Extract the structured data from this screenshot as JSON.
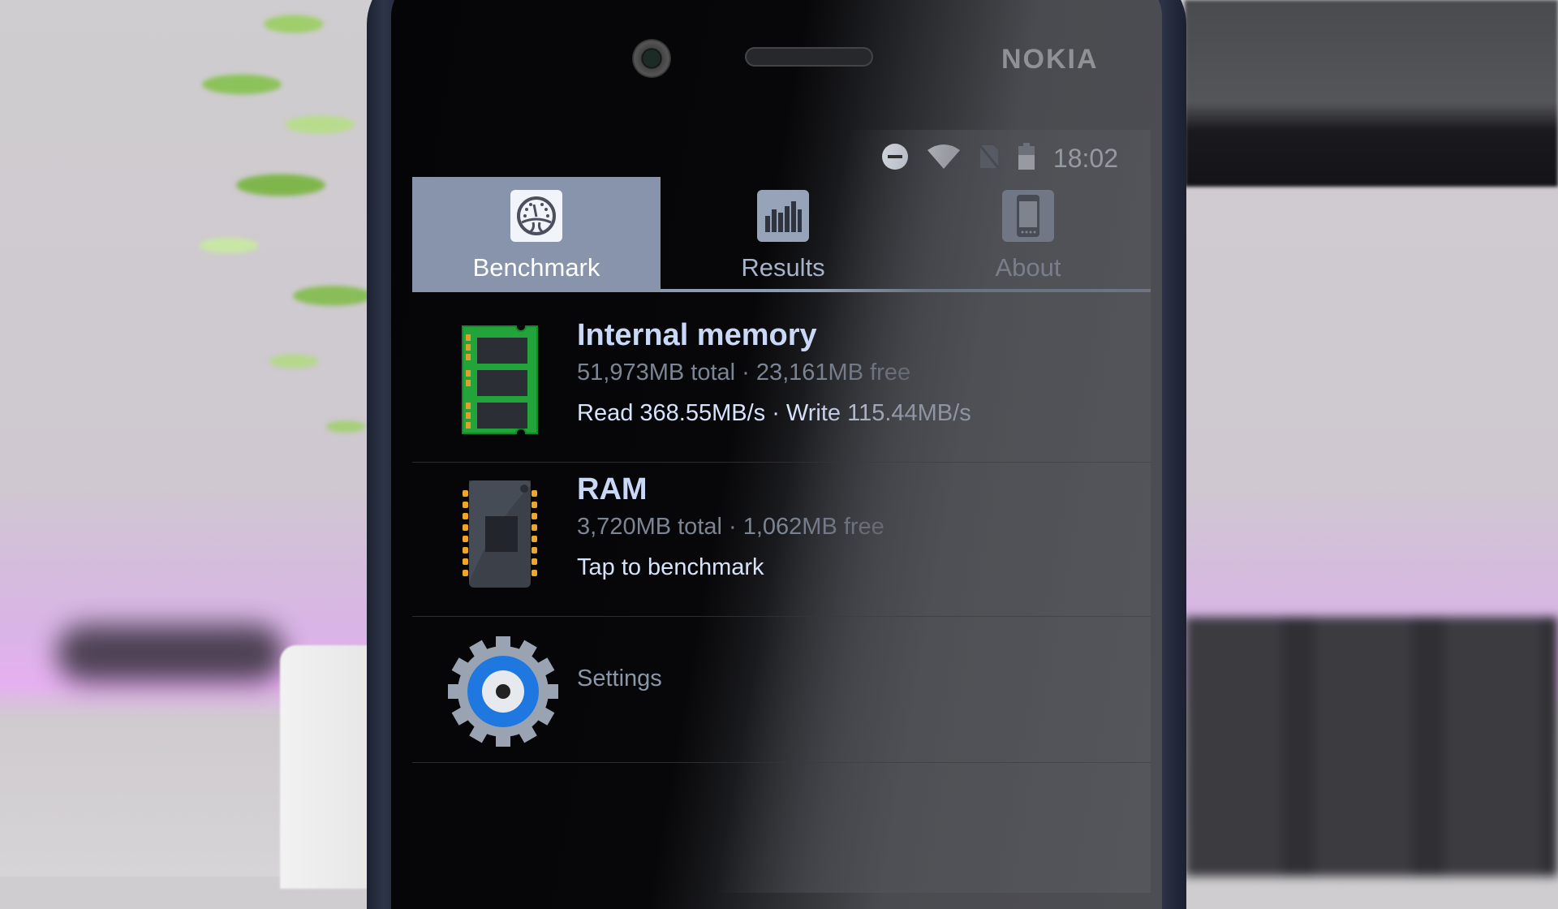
{
  "device": {
    "brand": "NOKIA"
  },
  "status_bar": {
    "icons": [
      "do-not-disturb-icon",
      "wifi-icon",
      "no-sim-icon",
      "battery-icon"
    ],
    "time": "18:02"
  },
  "tabs": [
    {
      "label": "Benchmark",
      "icon": "speedometer-icon",
      "active": true
    },
    {
      "label": "Results",
      "icon": "bar-chart-icon",
      "active": false
    },
    {
      "label": "About",
      "icon": "phone-icon",
      "active": false
    }
  ],
  "items": [
    {
      "title": "Internal memory",
      "subtitle": "51,973MB total · 23,161MB free",
      "detail": "Read 368.55MB/s · Write 115.44MB/s",
      "icon": "sd-card-icon"
    },
    {
      "title": "RAM",
      "subtitle": "3,720MB total · 1,062MB free",
      "detail": "Tap to benchmark",
      "icon": "ram-chip-icon"
    }
  ],
  "settings": {
    "label": "Settings",
    "icon": "gear-icon"
  },
  "colors": {
    "active_tab": "#8794ab",
    "title_text": "#c8d8f6",
    "secondary_text": "#7c8594",
    "card_green": "#22a43a",
    "gear_blue": "#1e78e0"
  }
}
